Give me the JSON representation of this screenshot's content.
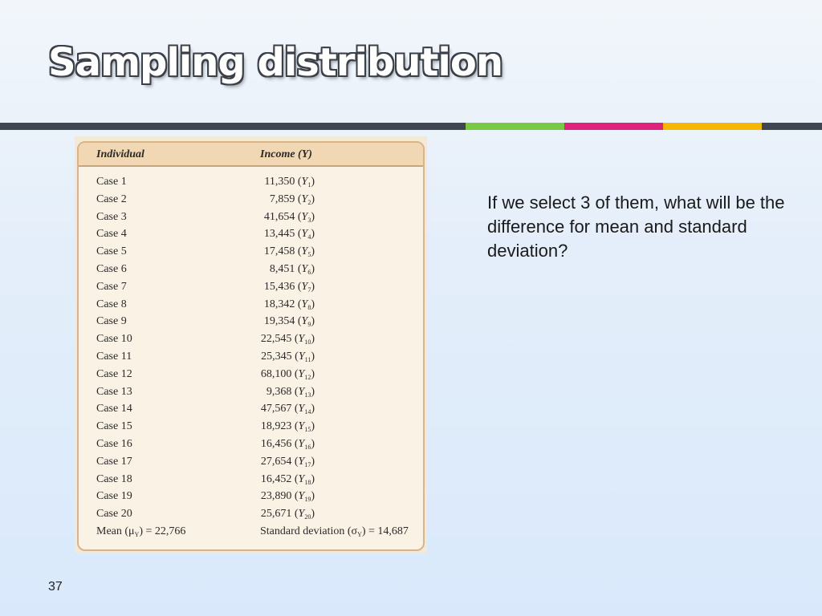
{
  "slide": {
    "title": "Sampling distribution",
    "question": "If we select 3 of them, what will be the difference for mean and standard deviation?",
    "page_number": "37",
    "accent_colors": [
      "#3f4551",
      "#7ac943",
      "#e0237a",
      "#f7b500"
    ]
  },
  "table": {
    "headers": {
      "individual": "Individual",
      "income": "Income (Y)"
    },
    "rows": [
      {
        "case": "Case 1",
        "income": "11,350",
        "sym": "Y",
        "sub": "1"
      },
      {
        "case": "Case 2",
        "income": "7,859",
        "sym": "Y",
        "sub": "2"
      },
      {
        "case": "Case 3",
        "income": "41,654",
        "sym": "Y",
        "sub": "3"
      },
      {
        "case": "Case 4",
        "income": "13,445",
        "sym": "Y",
        "sub": "4"
      },
      {
        "case": "Case 5",
        "income": "17,458",
        "sym": "Y",
        "sub": "5"
      },
      {
        "case": "Case 6",
        "income": "8,451",
        "sym": "Y",
        "sub": "6"
      },
      {
        "case": "Case 7",
        "income": "15,436",
        "sym": "Y",
        "sub": "7"
      },
      {
        "case": "Case 8",
        "income": "18,342",
        "sym": "Y",
        "sub": "8"
      },
      {
        "case": "Case 9",
        "income": "19,354",
        "sym": "Y",
        "sub": "9"
      },
      {
        "case": "Case 10",
        "income": "22,545",
        "sym": "Y",
        "sub": "10"
      },
      {
        "case": "Case 11",
        "income": "25,345",
        "sym": "Y",
        "sub": "11"
      },
      {
        "case": "Case 12",
        "income": "68,100",
        "sym": "Y",
        "sub": "12"
      },
      {
        "case": "Case 13",
        "income": "9,368",
        "sym": "Y",
        "sub": "13"
      },
      {
        "case": "Case 14",
        "income": "47,567",
        "sym": "Y",
        "sub": "14"
      },
      {
        "case": "Case 15",
        "income": "18,923",
        "sym": "Y",
        "sub": "15"
      },
      {
        "case": "Case 16",
        "income": "16,456",
        "sym": "Y",
        "sub": "16"
      },
      {
        "case": "Case 17",
        "income": "27,654",
        "sym": "Y",
        "sub": "17"
      },
      {
        "case": "Case 18",
        "income": "16,452",
        "sym": "Y",
        "sub": "18"
      },
      {
        "case": "Case 19",
        "income": "23,890",
        "sym": "Y",
        "sub": "19"
      },
      {
        "case": "Case 20",
        "income": "25,671",
        "sym": "Y",
        "sub": "20"
      }
    ],
    "footer": {
      "mean_prefix": "Mean (μ",
      "mean_sub": "Y",
      "mean_suffix": ") = 22,766",
      "sd_prefix": "Standard deviation (σ",
      "sd_sub": "Y",
      "sd_suffix": ") = 14,687"
    }
  }
}
